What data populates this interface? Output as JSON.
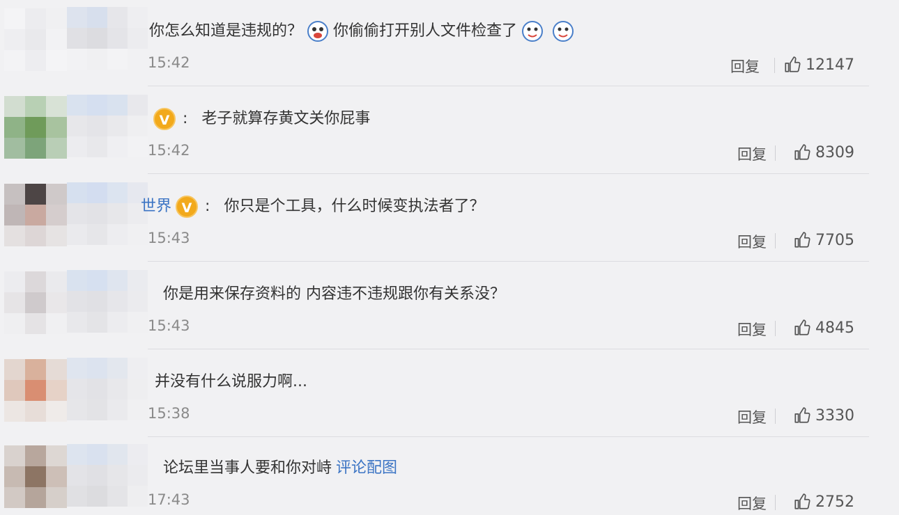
{
  "comments": [
    {
      "name_tail": "",
      "verified": false,
      "text": "你怎么知道是违规的？",
      "text2": "你偷偷打开别人文件检查了",
      "emojis_between": 1,
      "emojis_after": 2,
      "time": "15:42",
      "reply": "回复",
      "likes": "12147",
      "link": ""
    },
    {
      "name_tail": "",
      "verified": true,
      "text": "老子就算存黄文关你屁事",
      "text2": "",
      "time": "15:42",
      "reply": "回复",
      "likes": "8309",
      "link": ""
    },
    {
      "name_tail": "世界",
      "verified": true,
      "text": "你只是个工具，什么时候变执法者了？",
      "text2": "",
      "time": "15:43",
      "reply": "回复",
      "likes": "7705",
      "link": ""
    },
    {
      "name_tail": "",
      "verified": false,
      "text": "你是用来保存资料的 内容违不违规跟你有关系没？",
      "text2": "",
      "time": "15:43",
      "reply": "回复",
      "likes": "4845",
      "link": ""
    },
    {
      "name_tail": "",
      "verified": false,
      "text": "并没有什么说服力啊...",
      "text2": "",
      "time": "15:38",
      "reply": "回复",
      "likes": "3330",
      "link": ""
    },
    {
      "name_tail": "",
      "verified": false,
      "text": "论坛里当事人要和你对峙",
      "text2": "",
      "time": "17:43",
      "reply": "回复",
      "likes": "2752",
      "link": "评论配图"
    }
  ],
  "icons": {
    "verified": "v-badge-icon",
    "like": "thumbs-up-icon",
    "emoji": "doge-emoji-icon"
  },
  "colors": {
    "link": "#3b74c4",
    "verified": "#f2a91b",
    "background": "#f1f1f3"
  }
}
